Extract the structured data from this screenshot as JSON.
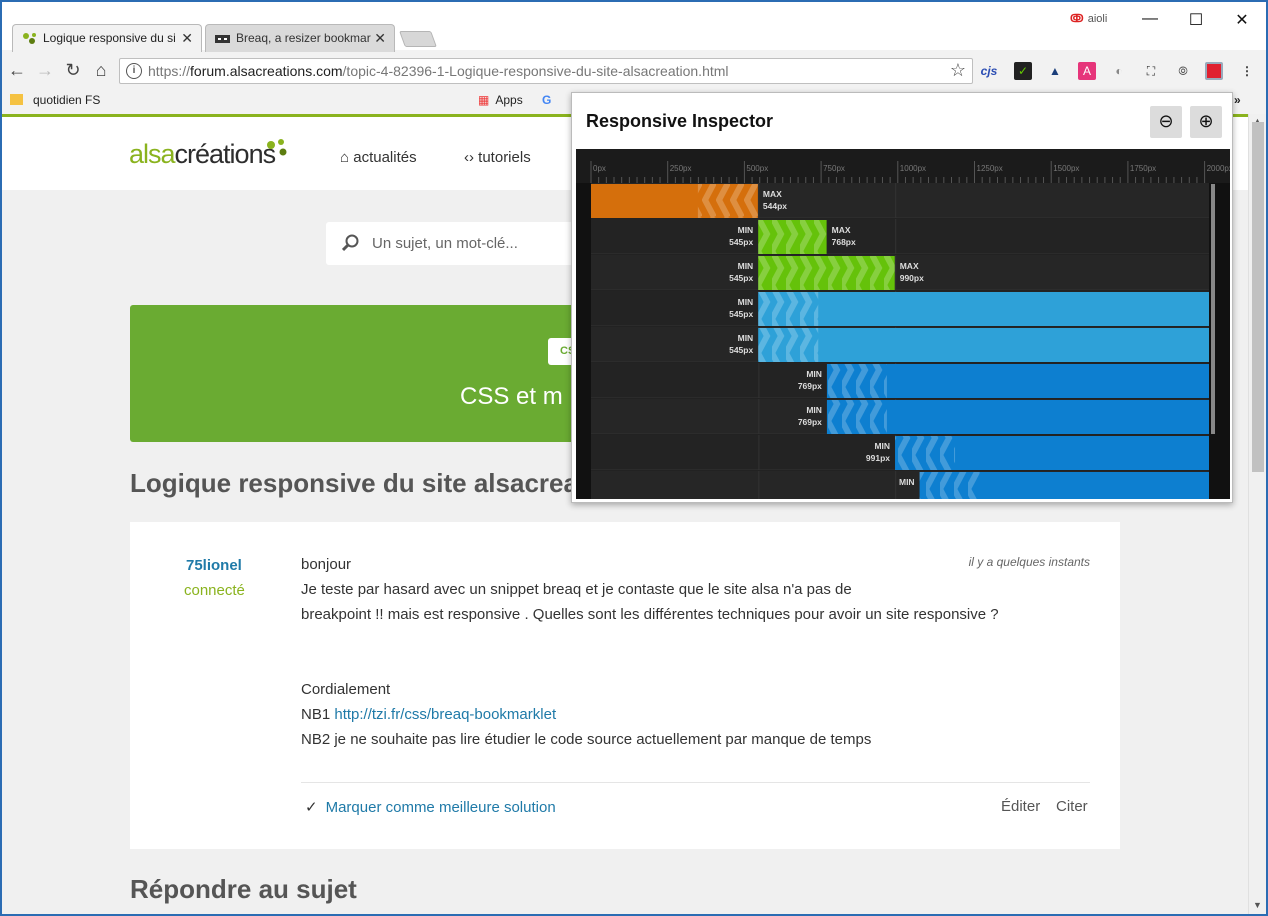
{
  "tabs": [
    {
      "label": "Logique responsive du si",
      "active": true
    },
    {
      "label": "Breaq, a resizer bookmar",
      "active": false
    }
  ],
  "window_controls": {
    "minimize": "—",
    "maximize": "☐",
    "close": "✕"
  },
  "profile": {
    "label": "aioli"
  },
  "address_bar": {
    "scheme": "https://",
    "host": "forum.alsacreations.com",
    "path": "/topic-4-82396-1-Logique-responsive-du-site-alsacreation.html"
  },
  "bookmarks": [
    {
      "label": "quotidien FS"
    },
    {
      "label": "Apps"
    },
    {
      "label": "G"
    }
  ],
  "extensions": [
    "cjs",
    "✓",
    "▲",
    "A",
    "◐",
    "⛶",
    "»"
  ],
  "site": {
    "logo_a": "alsa",
    "logo_b": "créations",
    "nav": [
      {
        "icon": "⌂",
        "label": "actualités"
      },
      {
        "icon": "‹›",
        "label": "tutoriels"
      }
    ],
    "search_placeholder": "Un sujet, un mot-clé...",
    "banner_chip": "CSS",
    "banner_title": "CSS et m",
    "topic_title": "Logique responsive du site alsacreation",
    "post": {
      "author": "75lionel",
      "status": "connecté",
      "time": "il y a quelques instants",
      "line1": "bonjour",
      "line2": "Je teste par hasard avec un snippet breaq et je contaste que le site alsa n'a pas de",
      "line3": "breakpoint !! mais est responsive . Quelles sont les différentes techniques pour avoir un site responsive ?",
      "line4": "Cordialement",
      "nb1_prefix": "NB1 ",
      "nb1_link": "http://tzi.fr/css/breaq-bookmarklet",
      "line6": "NB2 je ne souhaite pas lire étudier le code source actuellement par manque de temps",
      "best_solution": "Marquer comme meilleure solution",
      "edit": "Éditer",
      "quote": "Citer"
    },
    "reply_heading": "Répondre au sujet"
  },
  "inspector": {
    "title": "Responsive Inspector",
    "zoom_out": "⊖",
    "zoom_in": "⊕",
    "colors": {
      "max": "#d56f0c",
      "range": "#65c20a",
      "min_light": "#2ea1d8",
      "min_dark": "#0d7fd0"
    },
    "chart_data": {
      "type": "bar",
      "ruler_ticks": [
        "0px",
        "250px",
        "500px",
        "750px",
        "1000px",
        "1250px",
        "1500px",
        "1750px",
        "2000px"
      ],
      "xlim": [
        0,
        2000
      ],
      "rows": [
        {
          "kind": "max",
          "min": 0,
          "max": 544,
          "label1": "MAX",
          "label2": "544px",
          "color": "max"
        },
        {
          "kind": "range",
          "min": 545,
          "max": 768,
          "label1": "MIN",
          "label2": "545px",
          "label3": "MAX",
          "label4": "768px",
          "color": "range"
        },
        {
          "kind": "range",
          "min": 545,
          "max": 990,
          "label1": "MIN",
          "label2": "545px",
          "label3": "MAX",
          "label4": "990px",
          "color": "range"
        },
        {
          "kind": "min",
          "min": 545,
          "label1": "MIN",
          "label2": "545px",
          "color": "min_light"
        },
        {
          "kind": "min",
          "min": 545,
          "label1": "MIN",
          "label2": "545px",
          "color": "min_light"
        },
        {
          "kind": "min",
          "min": 769,
          "label1": "MIN",
          "label2": "769px",
          "color": "min_dark"
        },
        {
          "kind": "min",
          "min": 769,
          "label1": "MIN",
          "label2": "769px",
          "color": "min_dark"
        },
        {
          "kind": "min",
          "min": 991,
          "label1": "MIN",
          "label2": "991px",
          "color": "min_dark"
        },
        {
          "kind": "min",
          "min": 1071,
          "label1": "MIN",
          "label2": "",
          "color": "min_dark"
        }
      ]
    }
  }
}
